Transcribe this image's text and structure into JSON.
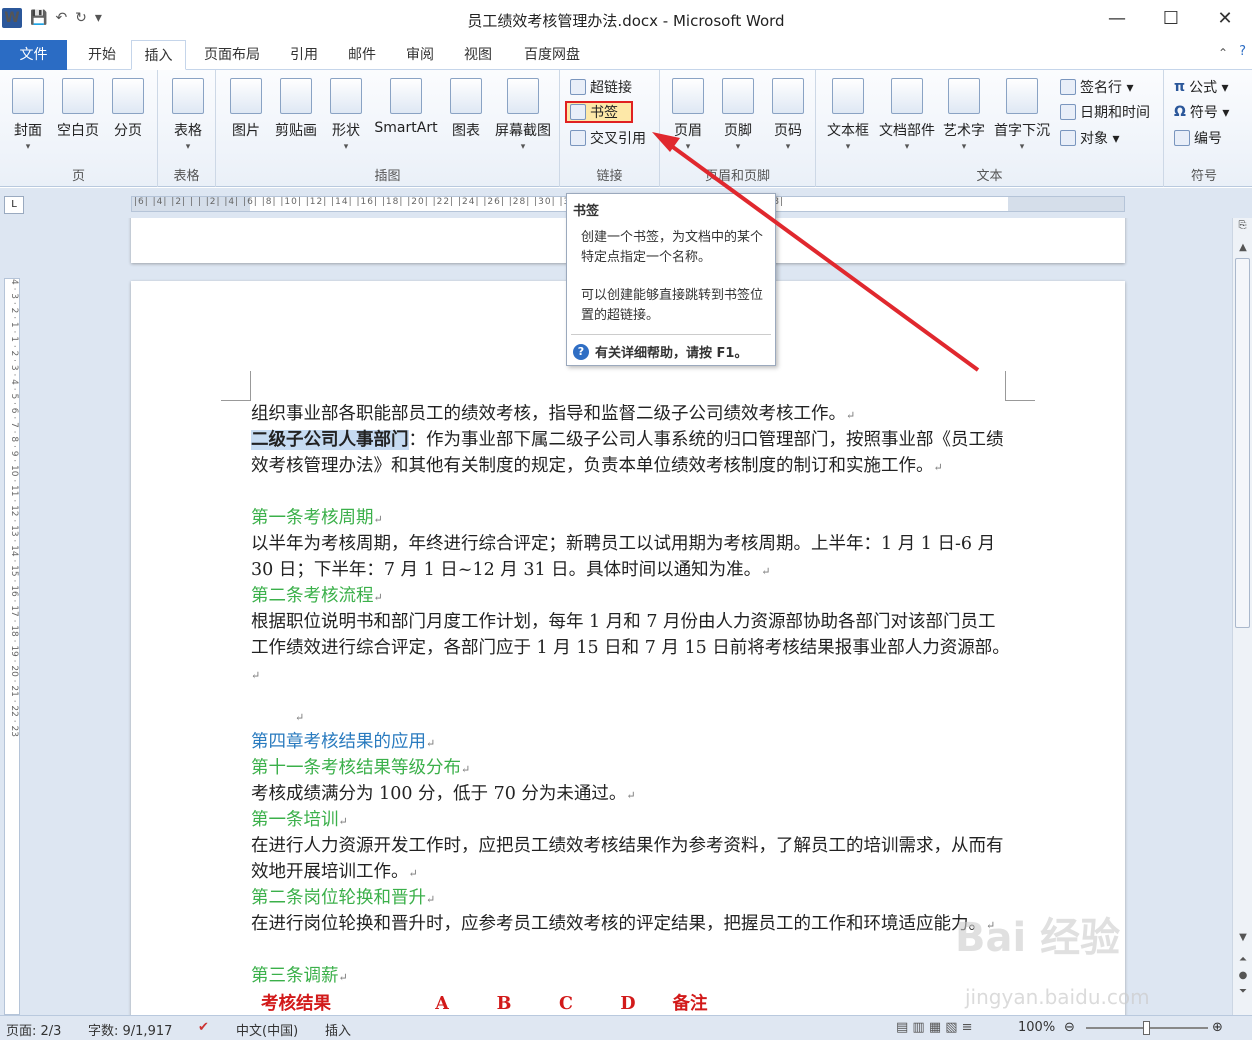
{
  "window": {
    "title": "员工绩效考核管理办法.docx - Microsoft Word",
    "minimize": "—",
    "maximize": "☐",
    "close": "✕"
  },
  "qat": {
    "logo": "W",
    "save": "💾",
    "undo": "↶",
    "redo": "↻",
    "more": "▾"
  },
  "tabs": [
    "文件",
    "开始",
    "插入",
    "页面布局",
    "引用",
    "邮件",
    "审阅",
    "视图",
    "百度网盘"
  ],
  "ribbon": {
    "groups": {
      "page": {
        "label": "页",
        "buttons": [
          "封面",
          "空白页",
          "分页"
        ]
      },
      "table": {
        "label": "表格",
        "buttons": [
          "表格"
        ]
      },
      "illustrations": {
        "label": "插图",
        "buttons": [
          "图片",
          "剪贴画",
          "形状",
          "SmartArt",
          "图表",
          "屏幕截图"
        ]
      },
      "links": {
        "label": "链接",
        "buttons": [
          "超链接",
          "书签",
          "交叉引用"
        ]
      },
      "header_footer": {
        "label": "页眉和页脚",
        "buttons": [
          "页眉",
          "页脚",
          "页码"
        ]
      },
      "text": {
        "label": "文本",
        "buttons": [
          "文本框",
          "文档部件",
          "艺术字",
          "首字下沉"
        ],
        "small": [
          "签名行 ▾",
          "日期和时间",
          "对象 ▾"
        ]
      },
      "symbols": {
        "label": "符号",
        "small": [
          "公式 ▾",
          "符号 ▾",
          "编号"
        ]
      }
    }
  },
  "ruler": {
    "corner": "L",
    "ticks": "|6| |4| |2| |  | |2| |4| |6| |8| |10| |12| |14| |16| |18| |20| |22| |24| |26| |28| |30| |32| |34| |36| |38| |40| |42| |44| |46| |48|",
    "vticks": "4 · 3 · 2 · 1 · 1 · 2 · 3 · 4 · 5 · 6 · 7 · 8 · 9 · 10 · 11 · 12 · 13 · 14 · 15 · 16 · 17 · 18 · 19 · 20 · 21 · 22 · 23"
  },
  "tooltip": {
    "title": "书签",
    "body1": "创建一个书签，为文档中的某个特定点指定一个名称。",
    "body2": "可以创建能够直接跳转到书签位置的超链接。",
    "footer": "有关详细帮助，请按 F1。"
  },
  "document": {
    "p1": "组织事业部各职能部员工的绩效考核，指导和监督二级子公司绩效考核工作。",
    "p2_sel": "二级子公司人事部门",
    "p2": "：作为事业部下属二级子公司人事系统的归口管理部门，按照事业部《员工绩效考核管理办法》和其他有关制度的规定，负责本单位绩效考核制度的制订和实施工作。",
    "h1": "第一条考核周期",
    "p3": "以半年为考核周期，年终进行综合评定；新聘员工以试用期为考核周期。上半年：1 月 1 日-6 月 30 日；下半年：7 月 1 日~12 月 31 日。具体时间以通知为准。",
    "h2": "第二条考核流程",
    "p4": "根据职位说明书和部门月度工作计划，每年 1 月和 7 月份由人力资源部协助各部门对该部门员工工作绩效进行综合评定，各部门应于 1 月 15 日和 7 月 15 日前将考核结果报事业部人力资源部。",
    "h3": "第四章考核结果的应用",
    "h4": "第十一条考核结果等级分布",
    "p5": "考核成绩满分为 100 分，低于 70 分为未通过。",
    "h5": "第一条培训",
    "p6": "在进行人力资源开发工作时，应把员工绩效考核结果作为参考资料，了解员工的培训需求，从而有效地开展培训工作。",
    "h6": "第二条岗位轮换和晋升",
    "p7": "在进行岗位轮换和晋升时，应参考员工绩效考核的评定结果，把握员工的工作和环境适应能力。",
    "h7": "第三条调薪",
    "table_row": [
      "考核结果",
      "A",
      "B",
      "C",
      "D",
      "备注"
    ],
    "pilcrow": "↵"
  },
  "status": {
    "page": "页面: 2/3",
    "words": "字数: 9/1,917",
    "lang": "中文(中国)",
    "mode": "插入",
    "zoom": "100%"
  },
  "watermark": {
    "main": "Bai 经验",
    "sub": "jingyan.baidu.com"
  }
}
